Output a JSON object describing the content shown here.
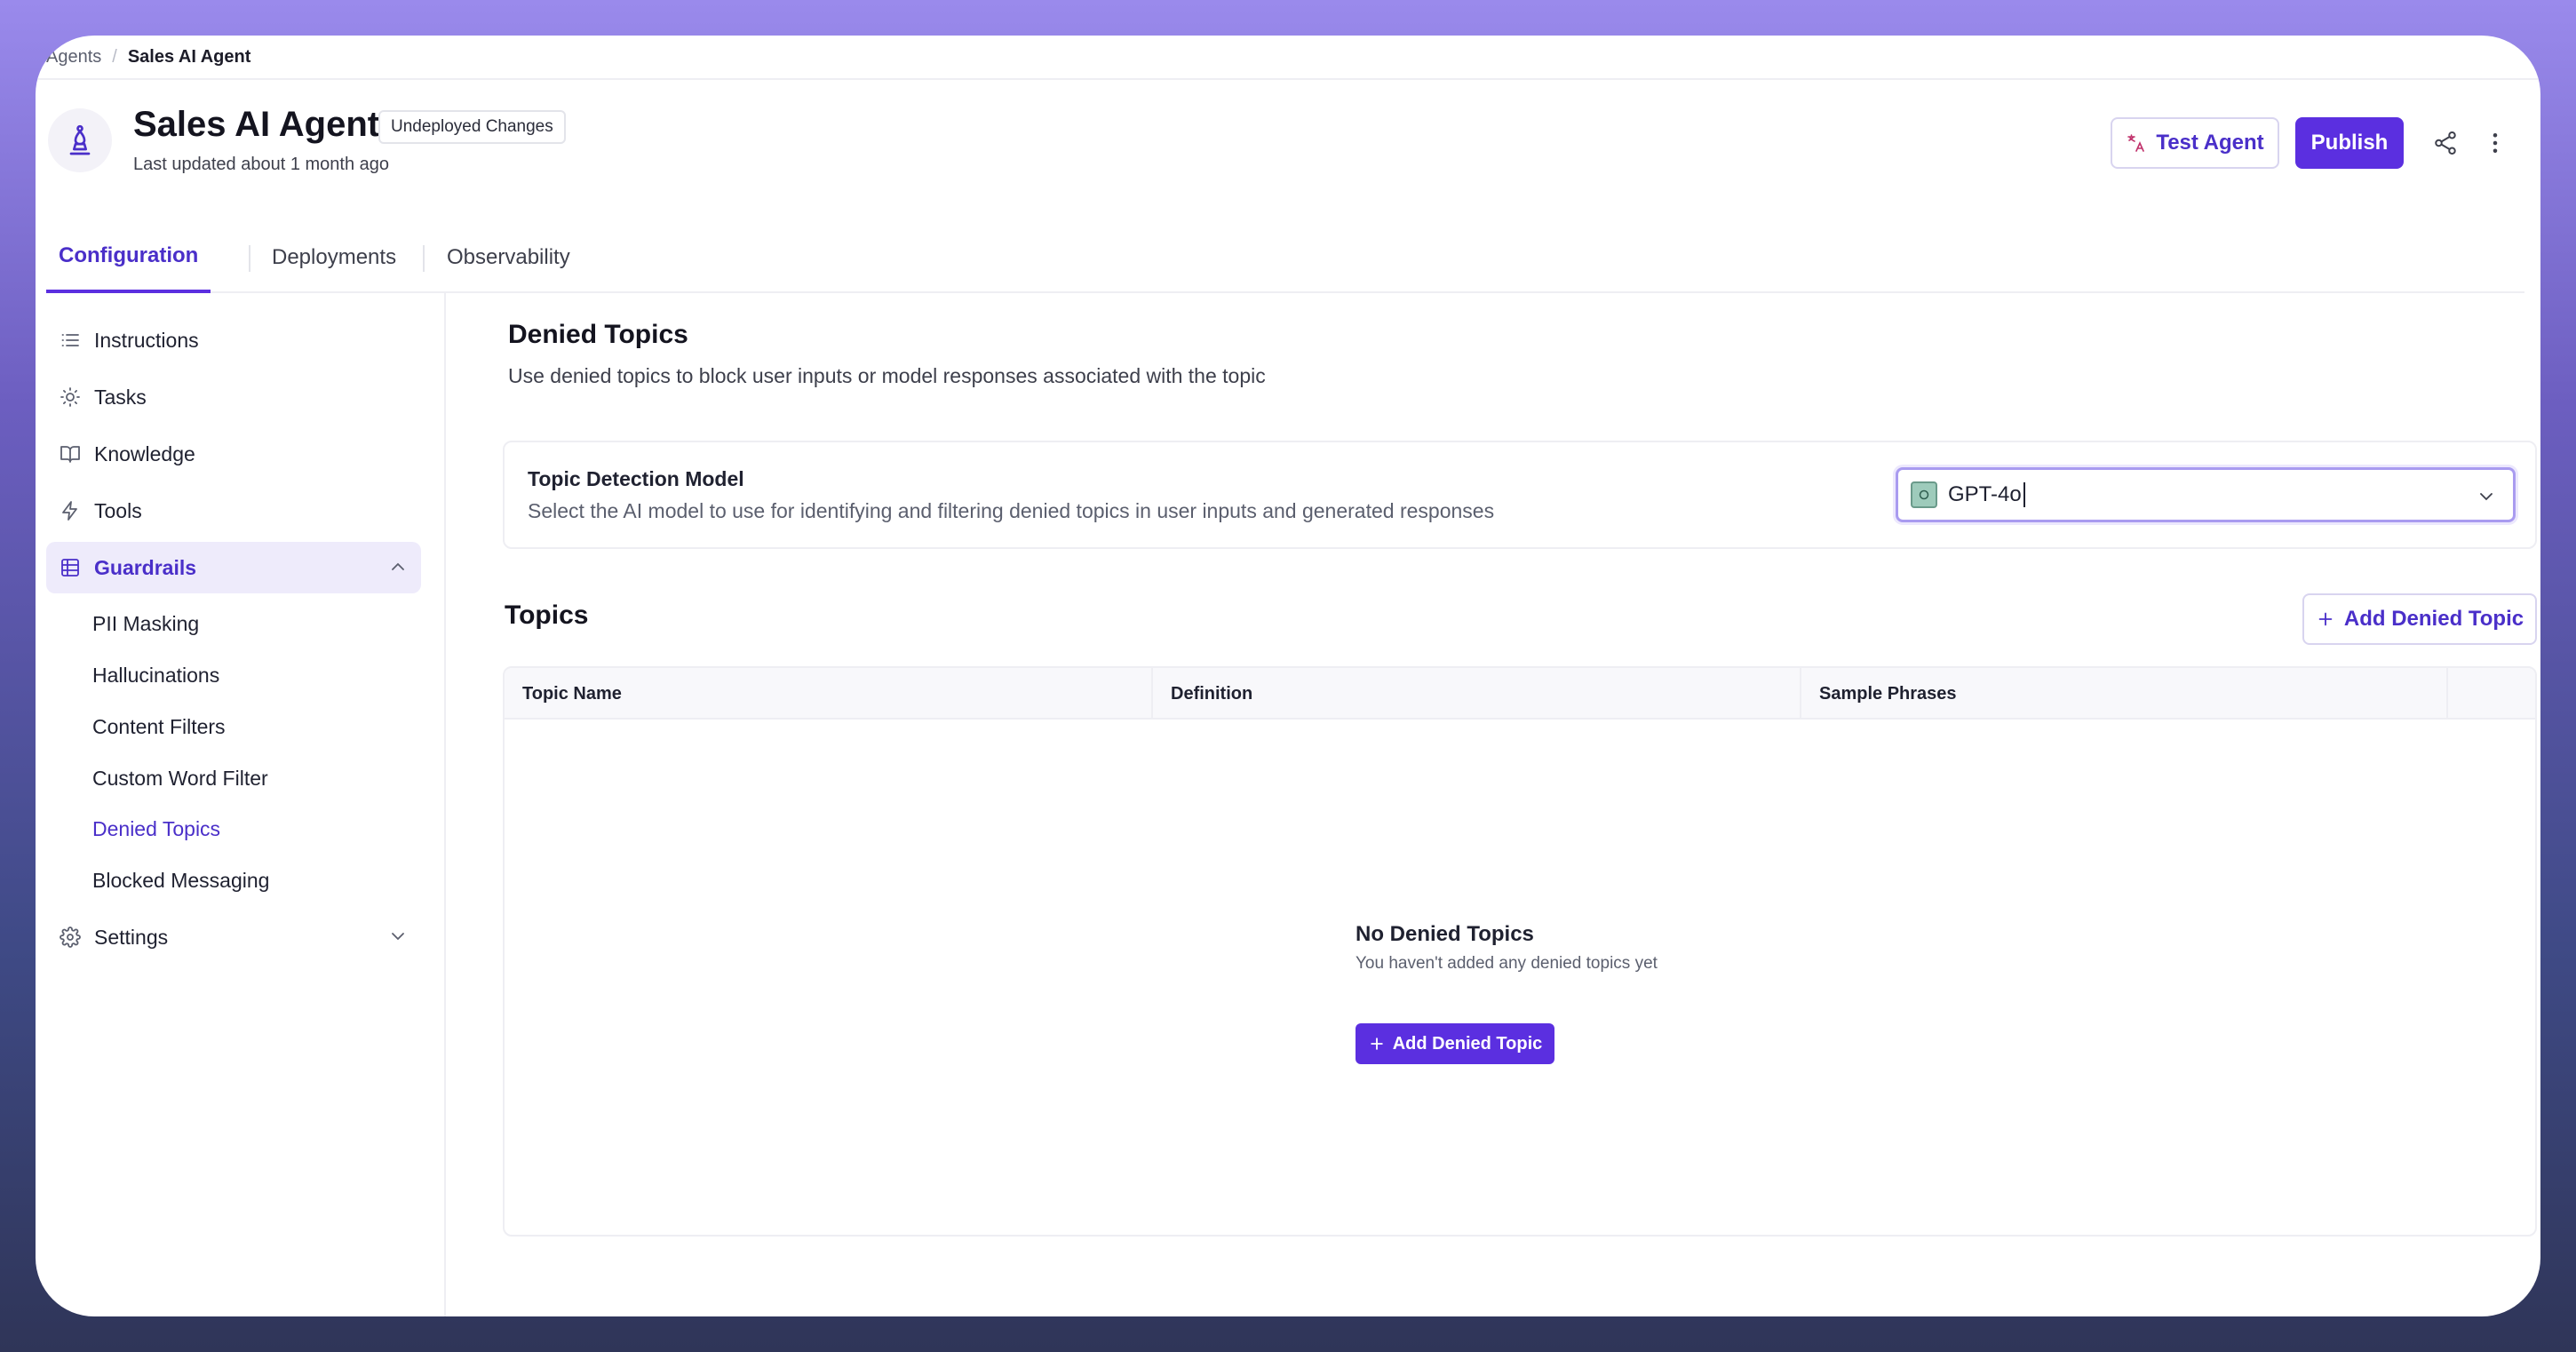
{
  "breadcrumb": {
    "root": "Agents",
    "separator": "/",
    "current": "Sales AI Agent"
  },
  "header": {
    "title": "Sales AI Agent",
    "badge": "Undeployed Changes",
    "subtitle": "Last updated about 1 month ago",
    "test_label": "Test Agent",
    "publish_label": "Publish"
  },
  "tabs": [
    {
      "label": "Configuration",
      "active": true
    },
    {
      "label": "Deployments",
      "active": false
    },
    {
      "label": "Observability",
      "active": false
    }
  ],
  "sidebar": {
    "items": [
      {
        "label": "Instructions",
        "icon": "list-icon"
      },
      {
        "label": "Tasks",
        "icon": "lightbulb-icon"
      },
      {
        "label": "Knowledge",
        "icon": "book-icon"
      },
      {
        "label": "Tools",
        "icon": "bolt-icon"
      },
      {
        "label": "Guardrails",
        "icon": "grid-icon",
        "expanded": true
      }
    ],
    "guardrails_children": [
      "PII Masking",
      "Hallucinations",
      "Content Filters",
      "Custom Word Filter",
      "Denied Topics",
      "Blocked Messaging"
    ],
    "settings": {
      "label": "Settings",
      "icon": "gear-icon"
    }
  },
  "main": {
    "title": "Denied Topics",
    "description": "Use denied topics to block user inputs or model responses associated with the topic",
    "model": {
      "label": "Topic Detection Model",
      "hint": "Select the AI model to use for identifying and filtering denied topics in user inputs and generated responses",
      "value": "GPT-4o"
    },
    "topics": {
      "title": "Topics",
      "add_label": "Add Denied Topic",
      "columns": [
        "Topic Name",
        "Definition",
        "Sample Phrases"
      ],
      "empty_title": "No Denied Topics",
      "empty_desc": "You haven't added any denied topics yet",
      "empty_button": "Add Denied Topic"
    }
  },
  "colors": {
    "accent": "#5b2fe0",
    "accent_text": "#4a2fc9"
  }
}
